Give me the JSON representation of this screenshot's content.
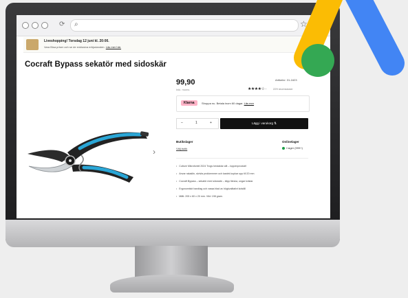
{
  "browser": {
    "reload_icon": "reload-icon",
    "search_icon": "search-icon",
    "star_icon": "bookmark-star-icon"
  },
  "banner": {
    "title": "Liveshopping! Torsdag 12 juni kl. 20:00.",
    "text": "Vara Bisa priser och se de exklusiva erbjudanden.",
    "link": "Läs mer här."
  },
  "product": {
    "title": "Cocraft Bypass sekatör med sidoskär",
    "price": "99,90",
    "price_note": "Inkl. moms",
    "article_no": "Artikelnr: 31-1623",
    "rating_stars": "★★★★☆ ·",
    "reviews": "229 recensioner",
    "next_arrow": "›"
  },
  "klarna": {
    "badge": "Klarna",
    "text": "Shoppa nu. Betala inom 60 dagar.",
    "link": "Läs mer"
  },
  "purchase": {
    "minus": "–",
    "quantity": "1",
    "plus": "+",
    "buy_label": "Lägg i varukorg ⇅"
  },
  "stock": {
    "store_heading": "Butikslager",
    "store_link": "Välj butik",
    "online_heading": "Onlinelager",
    "online_status": "I lager (999+)"
  },
  "features": [
    "Culture Mikrofonbil 2024 Trogs bestaklar allt – toppenprodukt!",
    "Anvar rakaklin, skrivla prokkemmer och kastek kupkar upp till 20 mm",
    "Cocraft Bypass – sekatör med sidoskär – klipp färska, ungar kvistar",
    "Ergonomiskt handtag och vassa blad av högkvalitativt kolstål",
    "Mått: 205 x 60 x 20 mm. Vikt: 198 gram."
  ],
  "colors": {
    "buy_button": "#111111",
    "klarna_pink": "#ffb3c7",
    "in_stock_green": "#1a9c44",
    "handle_blue": "#2aa6d6",
    "ads_blue": "#4285f4",
    "ads_yellow": "#fbbc04",
    "ads_green": "#34a853"
  }
}
